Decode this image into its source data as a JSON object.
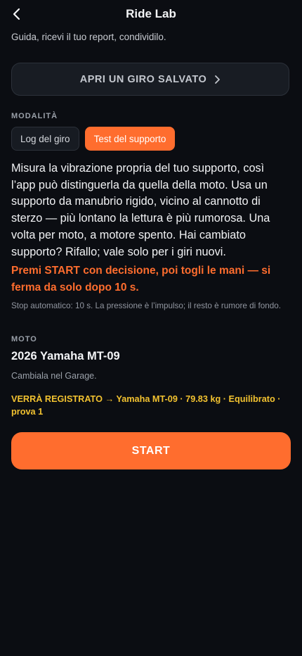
{
  "header": {
    "back_icon": "chevron-left-icon",
    "title": "Ride Lab"
  },
  "subtitle": "Guida, ricevi il tuo report, condividilo.",
  "saved_ride": {
    "label": "APRI UN GIRO SALVATO",
    "icon": "chevron-right-icon"
  },
  "mode": {
    "label": "MODALITÀ",
    "options": [
      {
        "label": "Log del giro",
        "active": false
      },
      {
        "label": "Test del supporto",
        "active": true
      }
    ]
  },
  "description": "Misura la vibrazione propria del tuo supporto, così l’app può distinguerla da quella della moto. Usa un supporto da manubrio rigido, vicino al cannotto di sterzo — più lontano la lettura è più rumorosa. Una volta per moto, a motore spento. Hai cambiato supporto? Rifallo; vale solo per i giri nuovi.",
  "instruction": "Premi START con decisione, poi togli le mani — si ferma da solo dopo 10 s.",
  "autostop_note": "Stop automatico: 10 s. La pressione è l’impulso; il resto è rumore di fondo.",
  "moto": {
    "label": "MOTO",
    "name": "2026 Yamaha MT-09",
    "hint": "Cambiala nel Garage."
  },
  "record_info": "VERRÀ REGISTRATO → Yamaha MT-09 · 79.83 kg · Equilibrato · prova 1",
  "start_label": "START",
  "colors": {
    "background": "#0b0d12",
    "accent": "#ff6d2e",
    "warning": "#f2c230",
    "surface": "#181c23"
  }
}
